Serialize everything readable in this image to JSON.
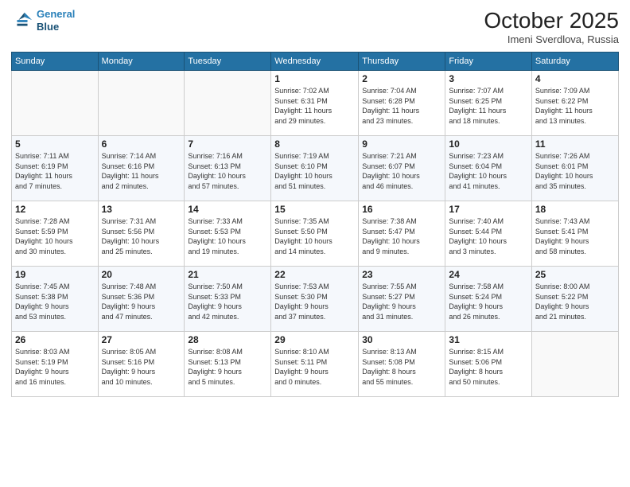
{
  "logo": {
    "line1": "General",
    "line2": "Blue"
  },
  "title": "October 2025",
  "location": "Imeni Sverdlova, Russia",
  "days_header": [
    "Sunday",
    "Monday",
    "Tuesday",
    "Wednesday",
    "Thursday",
    "Friday",
    "Saturday"
  ],
  "weeks": [
    [
      {
        "day": "",
        "info": ""
      },
      {
        "day": "",
        "info": ""
      },
      {
        "day": "",
        "info": ""
      },
      {
        "day": "1",
        "info": "Sunrise: 7:02 AM\nSunset: 6:31 PM\nDaylight: 11 hours\nand 29 minutes."
      },
      {
        "day": "2",
        "info": "Sunrise: 7:04 AM\nSunset: 6:28 PM\nDaylight: 11 hours\nand 23 minutes."
      },
      {
        "day": "3",
        "info": "Sunrise: 7:07 AM\nSunset: 6:25 PM\nDaylight: 11 hours\nand 18 minutes."
      },
      {
        "day": "4",
        "info": "Sunrise: 7:09 AM\nSunset: 6:22 PM\nDaylight: 11 hours\nand 13 minutes."
      }
    ],
    [
      {
        "day": "5",
        "info": "Sunrise: 7:11 AM\nSunset: 6:19 PM\nDaylight: 11 hours\nand 7 minutes."
      },
      {
        "day": "6",
        "info": "Sunrise: 7:14 AM\nSunset: 6:16 PM\nDaylight: 11 hours\nand 2 minutes."
      },
      {
        "day": "7",
        "info": "Sunrise: 7:16 AM\nSunset: 6:13 PM\nDaylight: 10 hours\nand 57 minutes."
      },
      {
        "day": "8",
        "info": "Sunrise: 7:19 AM\nSunset: 6:10 PM\nDaylight: 10 hours\nand 51 minutes."
      },
      {
        "day": "9",
        "info": "Sunrise: 7:21 AM\nSunset: 6:07 PM\nDaylight: 10 hours\nand 46 minutes."
      },
      {
        "day": "10",
        "info": "Sunrise: 7:23 AM\nSunset: 6:04 PM\nDaylight: 10 hours\nand 41 minutes."
      },
      {
        "day": "11",
        "info": "Sunrise: 7:26 AM\nSunset: 6:01 PM\nDaylight: 10 hours\nand 35 minutes."
      }
    ],
    [
      {
        "day": "12",
        "info": "Sunrise: 7:28 AM\nSunset: 5:59 PM\nDaylight: 10 hours\nand 30 minutes."
      },
      {
        "day": "13",
        "info": "Sunrise: 7:31 AM\nSunset: 5:56 PM\nDaylight: 10 hours\nand 25 minutes."
      },
      {
        "day": "14",
        "info": "Sunrise: 7:33 AM\nSunset: 5:53 PM\nDaylight: 10 hours\nand 19 minutes."
      },
      {
        "day": "15",
        "info": "Sunrise: 7:35 AM\nSunset: 5:50 PM\nDaylight: 10 hours\nand 14 minutes."
      },
      {
        "day": "16",
        "info": "Sunrise: 7:38 AM\nSunset: 5:47 PM\nDaylight: 10 hours\nand 9 minutes."
      },
      {
        "day": "17",
        "info": "Sunrise: 7:40 AM\nSunset: 5:44 PM\nDaylight: 10 hours\nand 3 minutes."
      },
      {
        "day": "18",
        "info": "Sunrise: 7:43 AM\nSunset: 5:41 PM\nDaylight: 9 hours\nand 58 minutes."
      }
    ],
    [
      {
        "day": "19",
        "info": "Sunrise: 7:45 AM\nSunset: 5:38 PM\nDaylight: 9 hours\nand 53 minutes."
      },
      {
        "day": "20",
        "info": "Sunrise: 7:48 AM\nSunset: 5:36 PM\nDaylight: 9 hours\nand 47 minutes."
      },
      {
        "day": "21",
        "info": "Sunrise: 7:50 AM\nSunset: 5:33 PM\nDaylight: 9 hours\nand 42 minutes."
      },
      {
        "day": "22",
        "info": "Sunrise: 7:53 AM\nSunset: 5:30 PM\nDaylight: 9 hours\nand 37 minutes."
      },
      {
        "day": "23",
        "info": "Sunrise: 7:55 AM\nSunset: 5:27 PM\nDaylight: 9 hours\nand 31 minutes."
      },
      {
        "day": "24",
        "info": "Sunrise: 7:58 AM\nSunset: 5:24 PM\nDaylight: 9 hours\nand 26 minutes."
      },
      {
        "day": "25",
        "info": "Sunrise: 8:00 AM\nSunset: 5:22 PM\nDaylight: 9 hours\nand 21 minutes."
      }
    ],
    [
      {
        "day": "26",
        "info": "Sunrise: 8:03 AM\nSunset: 5:19 PM\nDaylight: 9 hours\nand 16 minutes."
      },
      {
        "day": "27",
        "info": "Sunrise: 8:05 AM\nSunset: 5:16 PM\nDaylight: 9 hours\nand 10 minutes."
      },
      {
        "day": "28",
        "info": "Sunrise: 8:08 AM\nSunset: 5:13 PM\nDaylight: 9 hours\nand 5 minutes."
      },
      {
        "day": "29",
        "info": "Sunrise: 8:10 AM\nSunset: 5:11 PM\nDaylight: 9 hours\nand 0 minutes."
      },
      {
        "day": "30",
        "info": "Sunrise: 8:13 AM\nSunset: 5:08 PM\nDaylight: 8 hours\nand 55 minutes."
      },
      {
        "day": "31",
        "info": "Sunrise: 8:15 AM\nSunset: 5:06 PM\nDaylight: 8 hours\nand 50 minutes."
      },
      {
        "day": "",
        "info": ""
      }
    ]
  ]
}
